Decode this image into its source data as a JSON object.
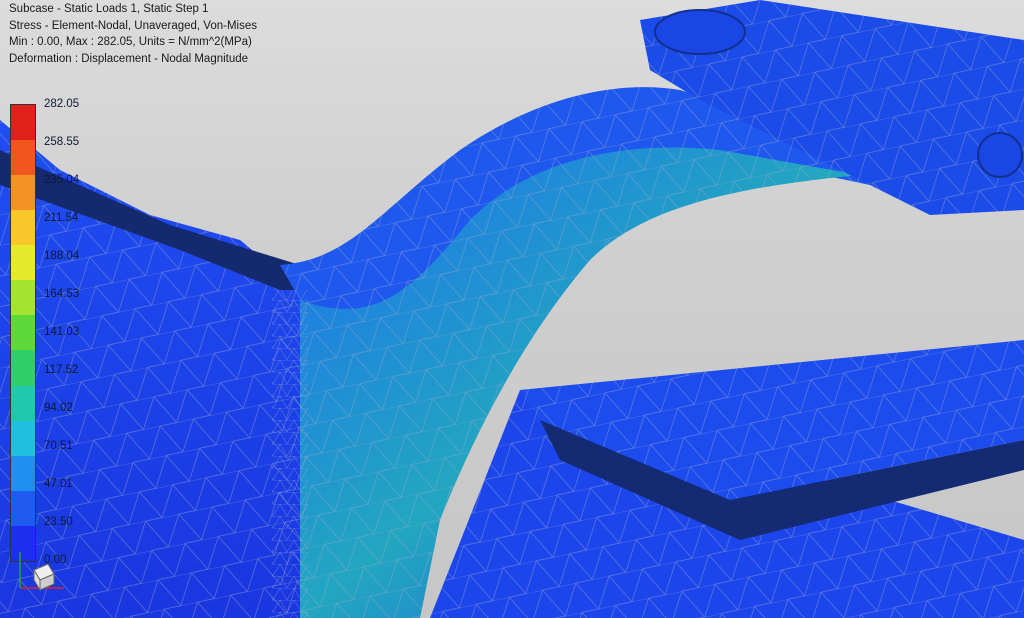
{
  "header": {
    "line1": "Subcase - Static Loads 1, Static Step 1",
    "line2": "Stress - Element-Nodal, Unaveraged, Von-Mises",
    "line3": "Min : 0.00, Max : 282.05, Units = N/mm^2(MPa)",
    "line4": "Deformation : Displacement - Nodal Magnitude"
  },
  "legend": {
    "max": 282.05,
    "min": 0.0,
    "ticks": [
      "282.05",
      "258.55",
      "235.04",
      "211.54",
      "188.04",
      "164.53",
      "141.03",
      "117.52",
      "94.02",
      "70.51",
      "47.01",
      "23.50",
      "0.00"
    ],
    "colors": [
      "#e0201b",
      "#f0561e",
      "#f49223",
      "#f8c72a",
      "#e6ea2d",
      "#a6e232",
      "#5fd83a",
      "#2fcf6a",
      "#20c9ad",
      "#1fbfe0",
      "#1f8ff0",
      "#1f5bf0",
      "#1d2ef0"
    ]
  },
  "triad": {
    "icon": "view-triad-icon"
  }
}
